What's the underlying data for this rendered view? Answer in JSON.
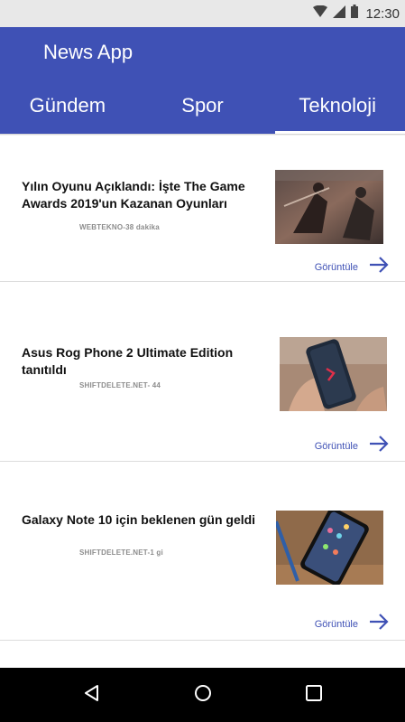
{
  "status_bar": {
    "time": "12:30",
    "icons": [
      "wifi-icon",
      "signal-icon",
      "battery-icon"
    ]
  },
  "app_bar": {
    "title": "News App",
    "color": "#3f51b5"
  },
  "tabs": [
    {
      "label": "Gündem",
      "active": false
    },
    {
      "label": "Spor",
      "active": false
    },
    {
      "label": "Teknoloji",
      "active": true
    }
  ],
  "articles": [
    {
      "title": "Yılın Oyunu Açıklandı: İşte The Game Awards 2019'un Kazanan Oyunları",
      "source": "WEBTEKNO-38 dakika",
      "action_label": "Görüntüle",
      "thumbnail": "game-awards-image"
    },
    {
      "title": "Asus Rog Phone 2 Ultimate Edition tanıtıldı",
      "source": "SHIFTDELETE.NET- 44",
      "action_label": "Görüntüle",
      "thumbnail": "rog-phone-image"
    },
    {
      "title": "Galaxy Note 10 için beklenen gün geldi",
      "source": "SHIFTDELETE.NET-1 gi",
      "action_label": "Görüntüle",
      "thumbnail": "galaxy-note-image"
    }
  ],
  "nav_bar": {
    "buttons": [
      "back-icon",
      "home-icon",
      "recents-icon"
    ]
  }
}
